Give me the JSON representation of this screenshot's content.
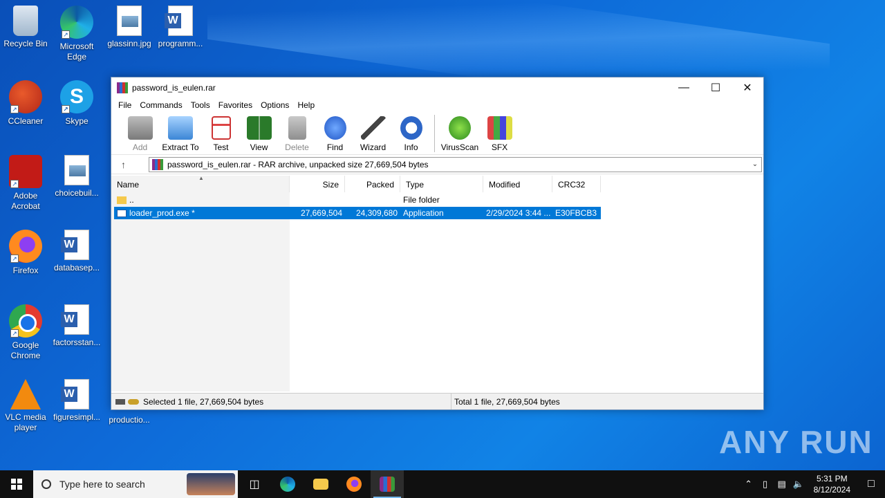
{
  "desktop": {
    "icons": [
      {
        "label": "Recycle Bin"
      },
      {
        "label": "Microsoft Edge"
      },
      {
        "label": "glassinn.jpg"
      },
      {
        "label": "programm..."
      },
      {
        "label": "CCleaner"
      },
      {
        "label": "Skype"
      },
      {
        "label": "Adobe Acrobat"
      },
      {
        "label": "choicebuil..."
      },
      {
        "label": "Firefox"
      },
      {
        "label": "databasep..."
      },
      {
        "label": "Google Chrome"
      },
      {
        "label": "factorsstan..."
      },
      {
        "label": "VLC media player"
      },
      {
        "label": "figuresimpl..."
      },
      {
        "label": "productio..."
      }
    ]
  },
  "window": {
    "title": "password_is_eulen.rar",
    "menu": [
      "File",
      "Commands",
      "Tools",
      "Favorites",
      "Options",
      "Help"
    ],
    "toolbar": [
      {
        "label": "Add",
        "icon": "add-icon",
        "disabled": true
      },
      {
        "label": "Extract To",
        "icon": "extract-to-icon"
      },
      {
        "label": "Test",
        "icon": "test-icon"
      },
      {
        "label": "View",
        "icon": "view-icon"
      },
      {
        "label": "Delete",
        "icon": "delete-icon",
        "disabled": true
      },
      {
        "label": "Find",
        "icon": "find-icon"
      },
      {
        "label": "Wizard",
        "icon": "wizard-icon"
      },
      {
        "label": "Info",
        "icon": "info-icon"
      },
      {
        "label": "VirusScan",
        "icon": "virusscan-icon"
      },
      {
        "label": "SFX",
        "icon": "sfx-icon"
      }
    ],
    "address": "password_is_eulen.rar - RAR archive, unpacked size 27,669,504 bytes",
    "columns": [
      "Name",
      "Size",
      "Packed",
      "Type",
      "Modified",
      "CRC32"
    ],
    "rows": [
      {
        "name": "..",
        "size": "",
        "packed": "",
        "type": "File folder",
        "modified": "",
        "crc": ""
      },
      {
        "name": "loader_prod.exe *",
        "size": "27,669,504",
        "packed": "24,309,680",
        "type": "Application",
        "modified": "2/29/2024 3:44 ...",
        "crc": "E30FBCB3"
      }
    ],
    "status_left": "Selected 1 file, 27,669,504 bytes",
    "status_right": "Total 1 file, 27,669,504 bytes"
  },
  "watermark": "ANY RUN",
  "taskbar": {
    "search_placeholder": "Type here to search",
    "time": "5:31 PM",
    "date": "8/12/2024"
  }
}
